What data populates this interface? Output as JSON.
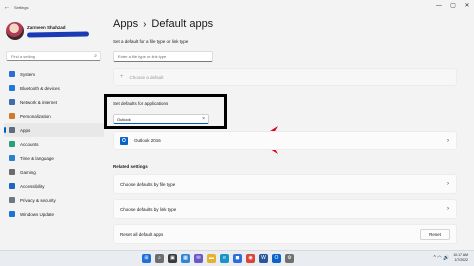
{
  "window": {
    "title": "Settings",
    "back_glyph": "←",
    "controls": [
      "—",
      "▢",
      "✕"
    ]
  },
  "profile": {
    "name": "Zarmeen Shahzad"
  },
  "sidebar": {
    "search_placeholder": "Find a setting",
    "items": [
      {
        "label": "System",
        "icon": "system-icon",
        "color": "#2b6fd6"
      },
      {
        "label": "Bluetooth & devices",
        "icon": "bluetooth-icon",
        "color": "#1f7ad9"
      },
      {
        "label": "Network & internet",
        "icon": "network-icon",
        "color": "#3d6fb0"
      },
      {
        "label": "Personalization",
        "icon": "brush-icon",
        "color": "#d17b2e"
      },
      {
        "label": "Apps",
        "icon": "apps-icon",
        "color": "#5d6b7e"
      },
      {
        "label": "Accounts",
        "icon": "accounts-icon",
        "color": "#2aa07a"
      },
      {
        "label": "Time & language",
        "icon": "globe-clock-icon",
        "color": "#2f7fcf"
      },
      {
        "label": "Gaming",
        "icon": "gaming-icon",
        "color": "#6c6c6c"
      },
      {
        "label": "Accessibility",
        "icon": "accessibility-icon",
        "color": "#1d66c2"
      },
      {
        "label": "Privacy & security",
        "icon": "shield-icon",
        "color": "#6f7784"
      },
      {
        "label": "Windows Update",
        "icon": "update-icon",
        "color": "#1c74d4"
      }
    ],
    "active_index": 4
  },
  "breadcrumb": {
    "parent": "Apps",
    "separator": "›",
    "current": "Default apps"
  },
  "file_type_section": {
    "label": "Set a default for a file type or link type",
    "input_placeholder": "Enter a file type or link type",
    "choose_default_label": "Choose a default",
    "plus_glyph": "+"
  },
  "apps_section": {
    "label": "Set defaults for applications",
    "search_value": "Outlook",
    "clear_glyph": "×",
    "results": [
      {
        "name": "Outlook 2016",
        "icon_letter": "O"
      }
    ]
  },
  "related_settings": {
    "label": "Related settings",
    "rows": [
      {
        "label": "Choose defaults by file type"
      },
      {
        "label": "Choose defaults by link type"
      }
    ],
    "reset_row": {
      "label": "Reset all default apps",
      "button_label": "Reset"
    }
  },
  "chevron_glyph": "›",
  "annotation": {
    "arrow_color": "#e0001b",
    "box_color": "#000000"
  },
  "taskbar": {
    "icons": [
      {
        "name": "start-icon",
        "glyph": "⊞",
        "color": "#1e6fd9"
      },
      {
        "name": "search-icon",
        "glyph": "⌕",
        "color": "#6d6d6d"
      },
      {
        "name": "task-view-icon",
        "glyph": "▣",
        "color": "#3b3b3b"
      },
      {
        "name": "widgets-icon",
        "glyph": "▦",
        "color": "#2f86d6"
      },
      {
        "name": "chat-icon",
        "glyph": "✉",
        "color": "#6a58c9"
      },
      {
        "name": "file-explorer-icon",
        "glyph": "▬",
        "color": "#e6b12d"
      },
      {
        "name": "edge-icon",
        "glyph": "e",
        "color": "#1a93c9"
      },
      {
        "name": "store-icon",
        "glyph": "◼",
        "color": "#2d6cdf"
      },
      {
        "name": "chrome-icon",
        "glyph": "◉",
        "color": "#db4437"
      },
      {
        "name": "word-icon",
        "glyph": "W",
        "color": "#2b579a"
      },
      {
        "name": "outlook-icon",
        "glyph": "O",
        "color": "#0a64c8"
      },
      {
        "name": "settings-gear-icon",
        "glyph": "⚙",
        "color": "#6f6f6f"
      }
    ],
    "tray_icons": "^ ◠ 🔊",
    "time": "10:17 AM",
    "date": "1/7/2022"
  }
}
